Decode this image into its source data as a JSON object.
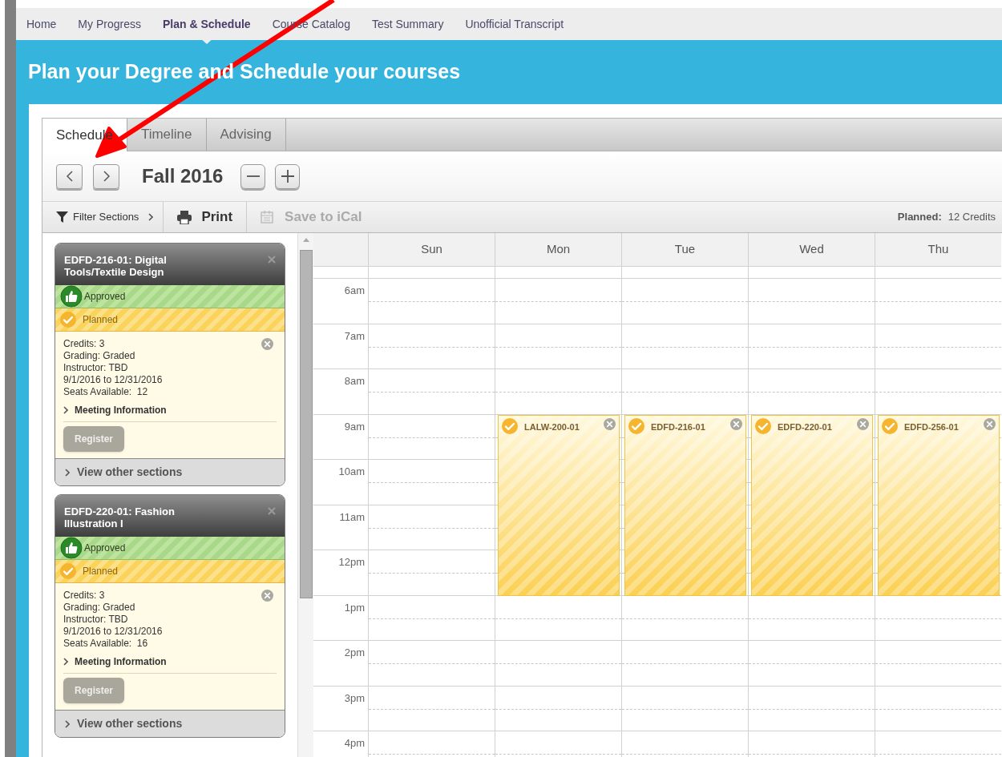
{
  "nav": [
    {
      "label": "Home",
      "selected": false
    },
    {
      "label": "My Progress",
      "selected": false
    },
    {
      "label": "Plan & Schedule",
      "selected": true
    },
    {
      "label": "Course Catalog",
      "selected": false
    },
    {
      "label": "Test Summary",
      "selected": false
    },
    {
      "label": "Unofficial Transcript",
      "selected": false
    }
  ],
  "page_title": "Plan your Degree and Schedule your courses",
  "tabs": [
    {
      "label": "Schedule",
      "selected": true
    },
    {
      "label": "Timeline",
      "selected": false
    },
    {
      "label": "Advising",
      "selected": false
    }
  ],
  "term": "Fall 2016",
  "toolbar": {
    "filter": "Filter Sections",
    "print": "Print",
    "ical": {
      "label": "Save to iCal",
      "disabled": true
    },
    "planned_label": "Planned:",
    "planned_value": "12 Credits"
  },
  "cards": [
    {
      "title": "EDFD-216-01: Digital Tools/Textile Design",
      "statuses": [
        {
          "kind": "approved",
          "label": "Approved"
        },
        {
          "kind": "planned",
          "label": "Planned"
        }
      ],
      "details": [
        "Credits: 3",
        "Grading: Graded",
        "Instructor: TBD",
        "9/1/2016 to 12/31/2016",
        "Seats Available:  12"
      ],
      "meeting": "Meeting Information",
      "button": {
        "label": "Register",
        "disabled": true
      },
      "other": "View other sections"
    },
    {
      "title": "EDFD-220-01: Fashion Illustration I",
      "statuses": [
        {
          "kind": "approved",
          "label": "Approved"
        },
        {
          "kind": "planned",
          "label": "Planned"
        }
      ],
      "details": [
        "Credits: 3",
        "Grading: Graded",
        "Instructor: TBD",
        "9/1/2016 to 12/31/2016",
        "Seats Available:  16"
      ],
      "meeting": "Meeting Information",
      "button": {
        "label": "Register",
        "disabled": true
      },
      "other": "View other sections"
    }
  ],
  "calendar": {
    "hours": [
      "6am",
      "7am",
      "8am",
      "9am",
      "10am",
      "11am",
      "12pm",
      "1pm",
      "2pm",
      "3pm",
      "4pm"
    ],
    "days": [
      {
        "label": "Sun"
      },
      {
        "label": "Mon",
        "events": [
          {
            "code": "LALW-200-01",
            "planned": true
          }
        ]
      },
      {
        "label": "Tue",
        "events": [
          {
            "code": "EDFD-216-01",
            "planned": true
          }
        ]
      },
      {
        "label": "Wed",
        "events": [
          {
            "code": "EDFD-220-01",
            "planned": true
          }
        ]
      },
      {
        "label": "Thu",
        "events": [
          {
            "code": "EDFD-256-01",
            "planned": true
          }
        ]
      }
    ]
  }
}
